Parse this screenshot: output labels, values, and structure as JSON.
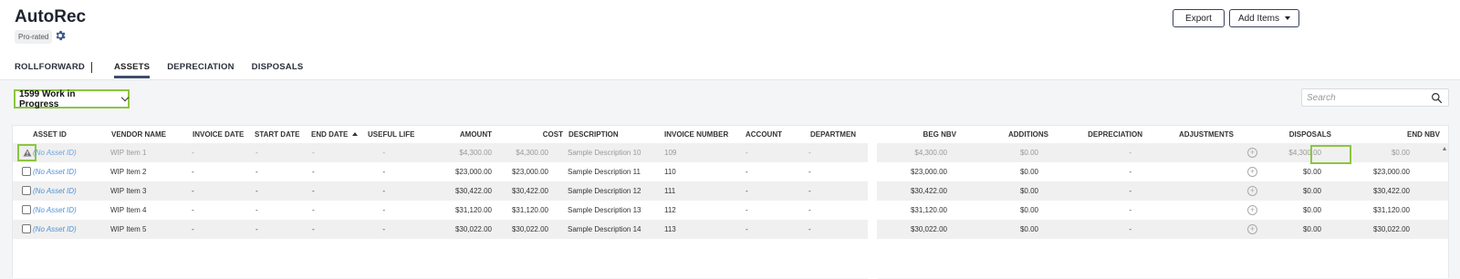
{
  "app": {
    "title": "AutoRec",
    "badge": "Pro-rated"
  },
  "toolbar": {
    "export_label": "Export",
    "add_items_label": "Add Items"
  },
  "tabs": [
    "ROLLFORWARD",
    "ASSETS",
    "DEPRECIATION",
    "DISPOSALS"
  ],
  "active_tab": "ASSETS",
  "group_select": {
    "value": "1599 Work in Progress"
  },
  "search": {
    "placeholder": "Search"
  },
  "columns": {
    "asset_id": "ASSET ID",
    "vendor": "VENDOR NAME",
    "invoice_date": "INVOICE DATE",
    "start_date": "START DATE",
    "end_date": "END DATE",
    "useful_life": "USEFUL LIFE",
    "amount": "AMOUNT",
    "cost": "COST",
    "description": "DESCRIPTION",
    "invoice_number": "INVOICE NUMBER",
    "account": "ACCOUNT",
    "department": "DEPARTMEN",
    "beg_nbv": "BEG NBV",
    "additions": "ADDITIONS",
    "depreciation": "DEPRECIATION",
    "adjustments": "ADJUSTMENTS",
    "disposals": "DISPOSALS",
    "end_nbv": "END NBV"
  },
  "sort": {
    "column": "END DATE",
    "direction": "ascending"
  },
  "rows": [
    {
      "asset_id": "(No Asset ID)",
      "vendor": "WIP Item 1",
      "invoice_date": "-",
      "start_date": "-",
      "end_date": "-",
      "useful_life": "-",
      "amount": "$4,300.00",
      "cost": "$4,300.00",
      "description": "Sample Description 10",
      "invoice_number": "109",
      "account": "-",
      "department": "-",
      "beg_nbv": "$4,300.00",
      "additions": "$0.00",
      "depreciation": "-",
      "disposals": "$4,300.00",
      "end_nbv": "$0.00",
      "status": "warning"
    },
    {
      "asset_id": "(No Asset ID)",
      "vendor": "WIP Item 2",
      "invoice_date": "-",
      "start_date": "-",
      "end_date": "-",
      "useful_life": "-",
      "amount": "$23,000.00",
      "cost": "$23,000.00",
      "description": "Sample Description 11",
      "invoice_number": "110",
      "account": "-",
      "department": "-",
      "beg_nbv": "$23,000.00",
      "additions": "$0.00",
      "depreciation": "-",
      "disposals": "$0.00",
      "end_nbv": "$23,000.00",
      "status": "checkbox"
    },
    {
      "asset_id": "(No Asset ID)",
      "vendor": "WIP Item 3",
      "invoice_date": "-",
      "start_date": "-",
      "end_date": "-",
      "useful_life": "-",
      "amount": "$30,422.00",
      "cost": "$30,422.00",
      "description": "Sample Description 12",
      "invoice_number": "111",
      "account": "-",
      "department": "-",
      "beg_nbv": "$30,422.00",
      "additions": "$0.00",
      "depreciation": "-",
      "disposals": "$0.00",
      "end_nbv": "$30,422.00",
      "status": "checkbox"
    },
    {
      "asset_id": "(No Asset ID)",
      "vendor": "WIP Item 4",
      "invoice_date": "-",
      "start_date": "-",
      "end_date": "-",
      "useful_life": "-",
      "amount": "$31,120.00",
      "cost": "$31,120.00",
      "description": "Sample Description 13",
      "invoice_number": "112",
      "account": "-",
      "department": "-",
      "beg_nbv": "$31,120.00",
      "additions": "$0.00",
      "depreciation": "-",
      "disposals": "$0.00",
      "end_nbv": "$31,120.00",
      "status": "checkbox"
    },
    {
      "asset_id": "(No Asset ID)",
      "vendor": "WIP Item 5",
      "invoice_date": "-",
      "start_date": "-",
      "end_date": "-",
      "useful_life": "-",
      "amount": "$30,022.00",
      "cost": "$30,022.00",
      "description": "Sample Description 14",
      "invoice_number": "113",
      "account": "-",
      "department": "-",
      "beg_nbv": "$30,022.00",
      "additions": "$0.00",
      "depreciation": "-",
      "disposals": "$0.00",
      "end_nbv": "$30,022.00",
      "status": "checkbox"
    }
  ],
  "colors": {
    "highlight": "#8cc63f",
    "link": "#4a90d9",
    "tab_underline": "#3d4e6b"
  },
  "icons": {
    "settings": "gear-icon",
    "search": "search-icon",
    "row_warning": "warning-icon",
    "adjust": "add-circle-icon"
  }
}
